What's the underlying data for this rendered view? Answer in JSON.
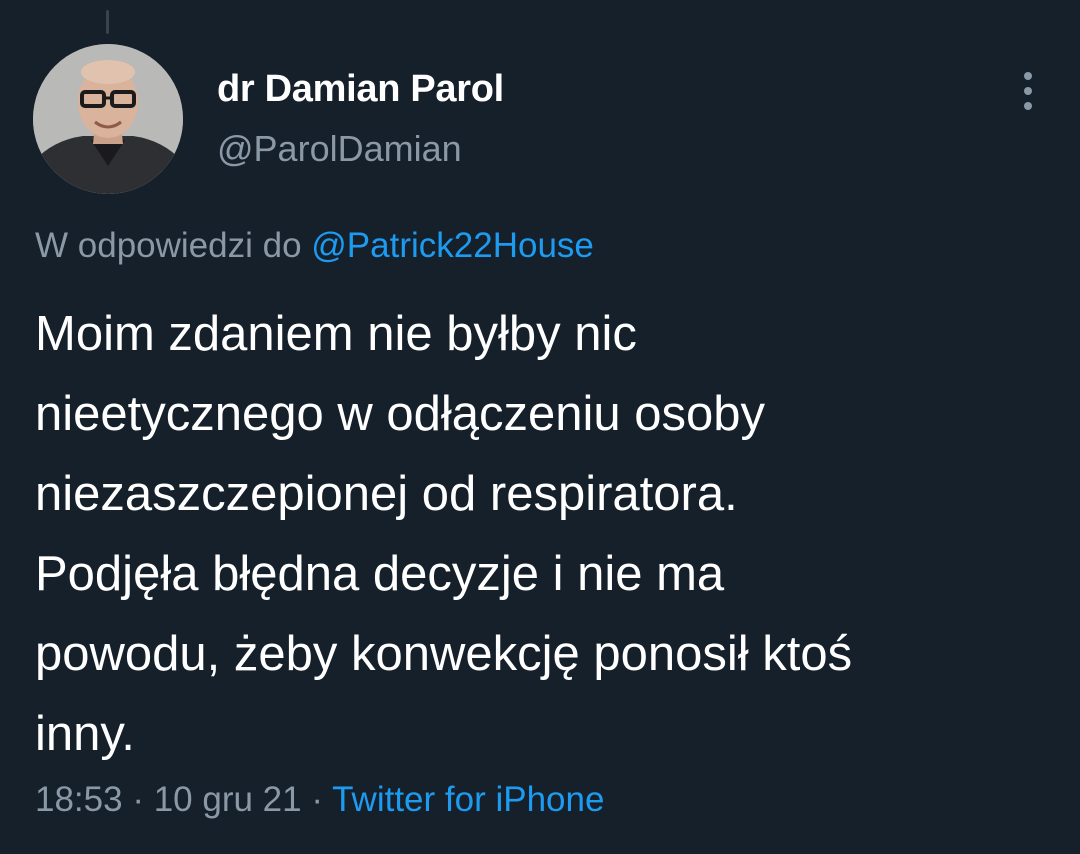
{
  "author": {
    "display_name": "dr Damian Parol",
    "handle": "@ParolDamian"
  },
  "reply": {
    "prefix": "W odpowiedzi do",
    "mention": "@Patrick22House"
  },
  "tweet": {
    "lines": [
      "Moim zdaniem nie byłby nic",
      "nieetycznego w odłączeniu osoby",
      "niezaszczepionej od respiratora.",
      "Podjęła błędna decyzje i nie ma",
      "powodu, żeby konwekcję ponosił ktoś",
      "inny."
    ]
  },
  "meta": {
    "time": "18:53",
    "separator": "·",
    "date": "10 gru 21",
    "source": "Twitter for iPhone"
  },
  "colors": {
    "background": "#15202b",
    "text_primary": "#ffffff",
    "text_secondary": "#8b98a5",
    "link": "#1d9bf0"
  },
  "icons": {
    "more": "more-vertical-icon"
  }
}
